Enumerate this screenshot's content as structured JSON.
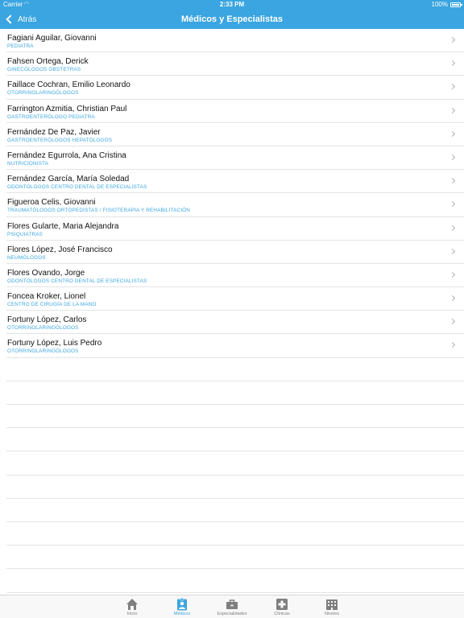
{
  "status_bar": {
    "carrier": "Carrier",
    "time": "2:33 PM",
    "battery": "100%"
  },
  "nav": {
    "back_label": "Atrás",
    "title": "Médicos y Especialistas"
  },
  "doctors": [
    {
      "name": "Fagiani Aguilar, Giovanni",
      "specialty": "PEDIATRA"
    },
    {
      "name": "Fahsen Ortega, Derick",
      "specialty": "GINECÓLOGOS OBSTETRAS"
    },
    {
      "name": "Faillace Cochran, Emilio Leonardo",
      "specialty": "OTORRINOLARINGÓLOGOS"
    },
    {
      "name": "Farrington Azmitia, Christian Paul",
      "specialty": "GASTROENTERÓLOGO PEDIATRA"
    },
    {
      "name": "Fernández De Paz, Javier",
      "specialty": "GASTROENTERÓLOGOS HEPATÓLOGOS"
    },
    {
      "name": "Fernández Egurrola, Ana Cristina",
      "specialty": "NUTRICIONISTA"
    },
    {
      "name": "Fernández García, María Soledad",
      "specialty": "ODONTÓLOGOS CENTRO DENTAL DE ESPECIALISTAS"
    },
    {
      "name": "Figueroa Celis, Giovanni",
      "specialty": "TRAUMATÓLOGOS ORTOPEDISTAS / FISIOTERAPIA Y REHABILITACIÓN"
    },
    {
      "name": "Flores Gularte, Maria Alejandra",
      "specialty": "PSIQUIATRAS"
    },
    {
      "name": "Flores López, José Francisco",
      "specialty": "NEUMÓLOGOS"
    },
    {
      "name": "Flores Ovando, Jorge",
      "specialty": "ODONTÓLOGOS CENTRO DENTAL DE ESPECIALISTAS"
    },
    {
      "name": "Foncea Kroker, Lionel",
      "specialty": "CENTRO DE CIRUGÍA DE LA MANO"
    },
    {
      "name": "Fortuny López, Carlos",
      "specialty": "OTORRINOLARINGÓLOGOS"
    },
    {
      "name": "Fortuny López, Luis Pedro",
      "specialty": "OTORRINOLARINGÓLOGOS"
    }
  ],
  "tabs": [
    {
      "label": "Inicio",
      "icon": "home-icon",
      "active": false
    },
    {
      "label": "Médicos",
      "icon": "doctor-badge-icon",
      "active": true
    },
    {
      "label": "Especialidades",
      "icon": "briefcase-icon",
      "active": false
    },
    {
      "label": "Clínicas",
      "icon": "medical-cross-icon",
      "active": false
    },
    {
      "label": "Niveles",
      "icon": "building-icon",
      "active": false
    }
  ],
  "colors": {
    "accent": "#3aa5e0",
    "tab_inactive": "#7f7f7f",
    "separator": "#e4e4e4"
  }
}
